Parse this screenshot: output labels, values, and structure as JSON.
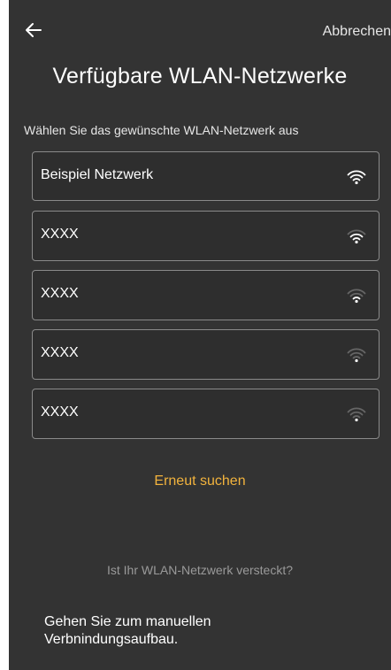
{
  "header": {
    "back_icon": "arrow-left-icon",
    "cancel_label": "Abbrechen"
  },
  "title": "Verfügbare WLAN-Netzwerke",
  "subtitle": "Wählen Sie das gewünschte WLAN-Netzwerk aus",
  "networks": [
    {
      "name": "Beispiel Netzwerk",
      "signal": 4
    },
    {
      "name": "XXXX",
      "signal": 3
    },
    {
      "name": "XXXX",
      "signal": 2
    },
    {
      "name": "XXXX",
      "signal": 1
    },
    {
      "name": "XXXX",
      "signal": 1
    }
  ],
  "rescan_label": "Erneut suchen",
  "hidden_question": "Ist Ihr WLAN-Netzwerk versteckt?",
  "manual_link": "Gehen Sie zum manuellen Verbnindungsaufbau.",
  "colors": {
    "background": "#333333",
    "accent": "#f2b33d",
    "signal_on": "#ffffff",
    "signal_off": "#666666"
  }
}
